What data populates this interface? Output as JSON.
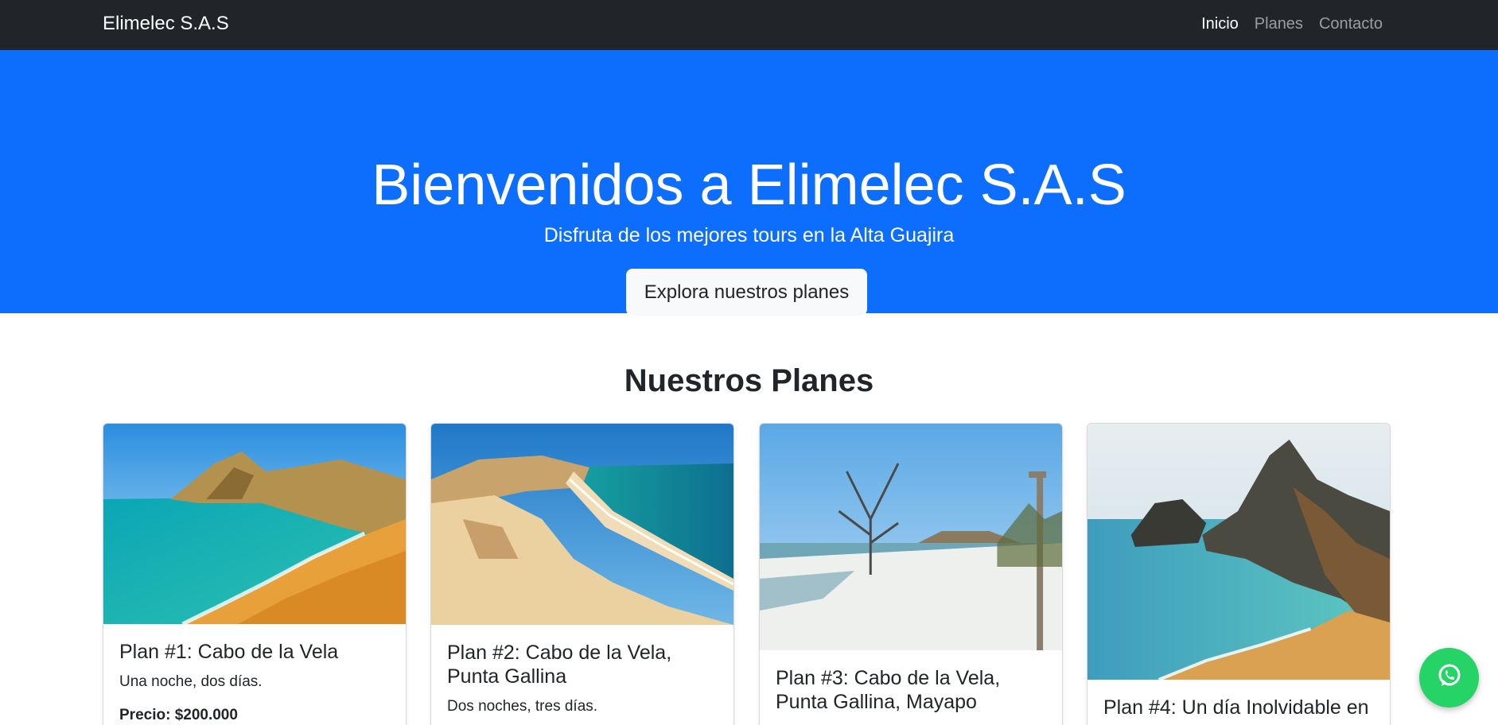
{
  "navbar": {
    "brand": "Elimelec S.A.S",
    "links": [
      {
        "label": "Inicio",
        "active": true
      },
      {
        "label": "Planes",
        "active": false
      },
      {
        "label": "Contacto",
        "active": false
      }
    ]
  },
  "hero": {
    "title": "Bienvenidos a Elimelec S.A.S",
    "subtitle": "Disfruta de los mejores tours en la Alta Guajira",
    "button_label": "Explora nuestros planes"
  },
  "plans_section": {
    "title": "Nuestros Planes",
    "cards": [
      {
        "title": "Plan #1: Cabo de la Vela",
        "description": "Una noche, dos días.",
        "price": "Precio: $200.000"
      },
      {
        "title": "Plan #2: Cabo de la Vela, Punta Gallina",
        "description": "Dos noches, tres días.",
        "price": ""
      },
      {
        "title": "Plan #3: Cabo de la Vela, Punta Gallina, Mayapo",
        "description": "",
        "price": ""
      },
      {
        "title": "Plan #4: Un día Inolvidable en",
        "description": "",
        "price": ""
      }
    ]
  },
  "floating": {
    "icon": "whatsapp-icon"
  },
  "colors": {
    "navbar": "#212529",
    "hero": "#0d6efd",
    "whatsapp": "#25d366"
  }
}
